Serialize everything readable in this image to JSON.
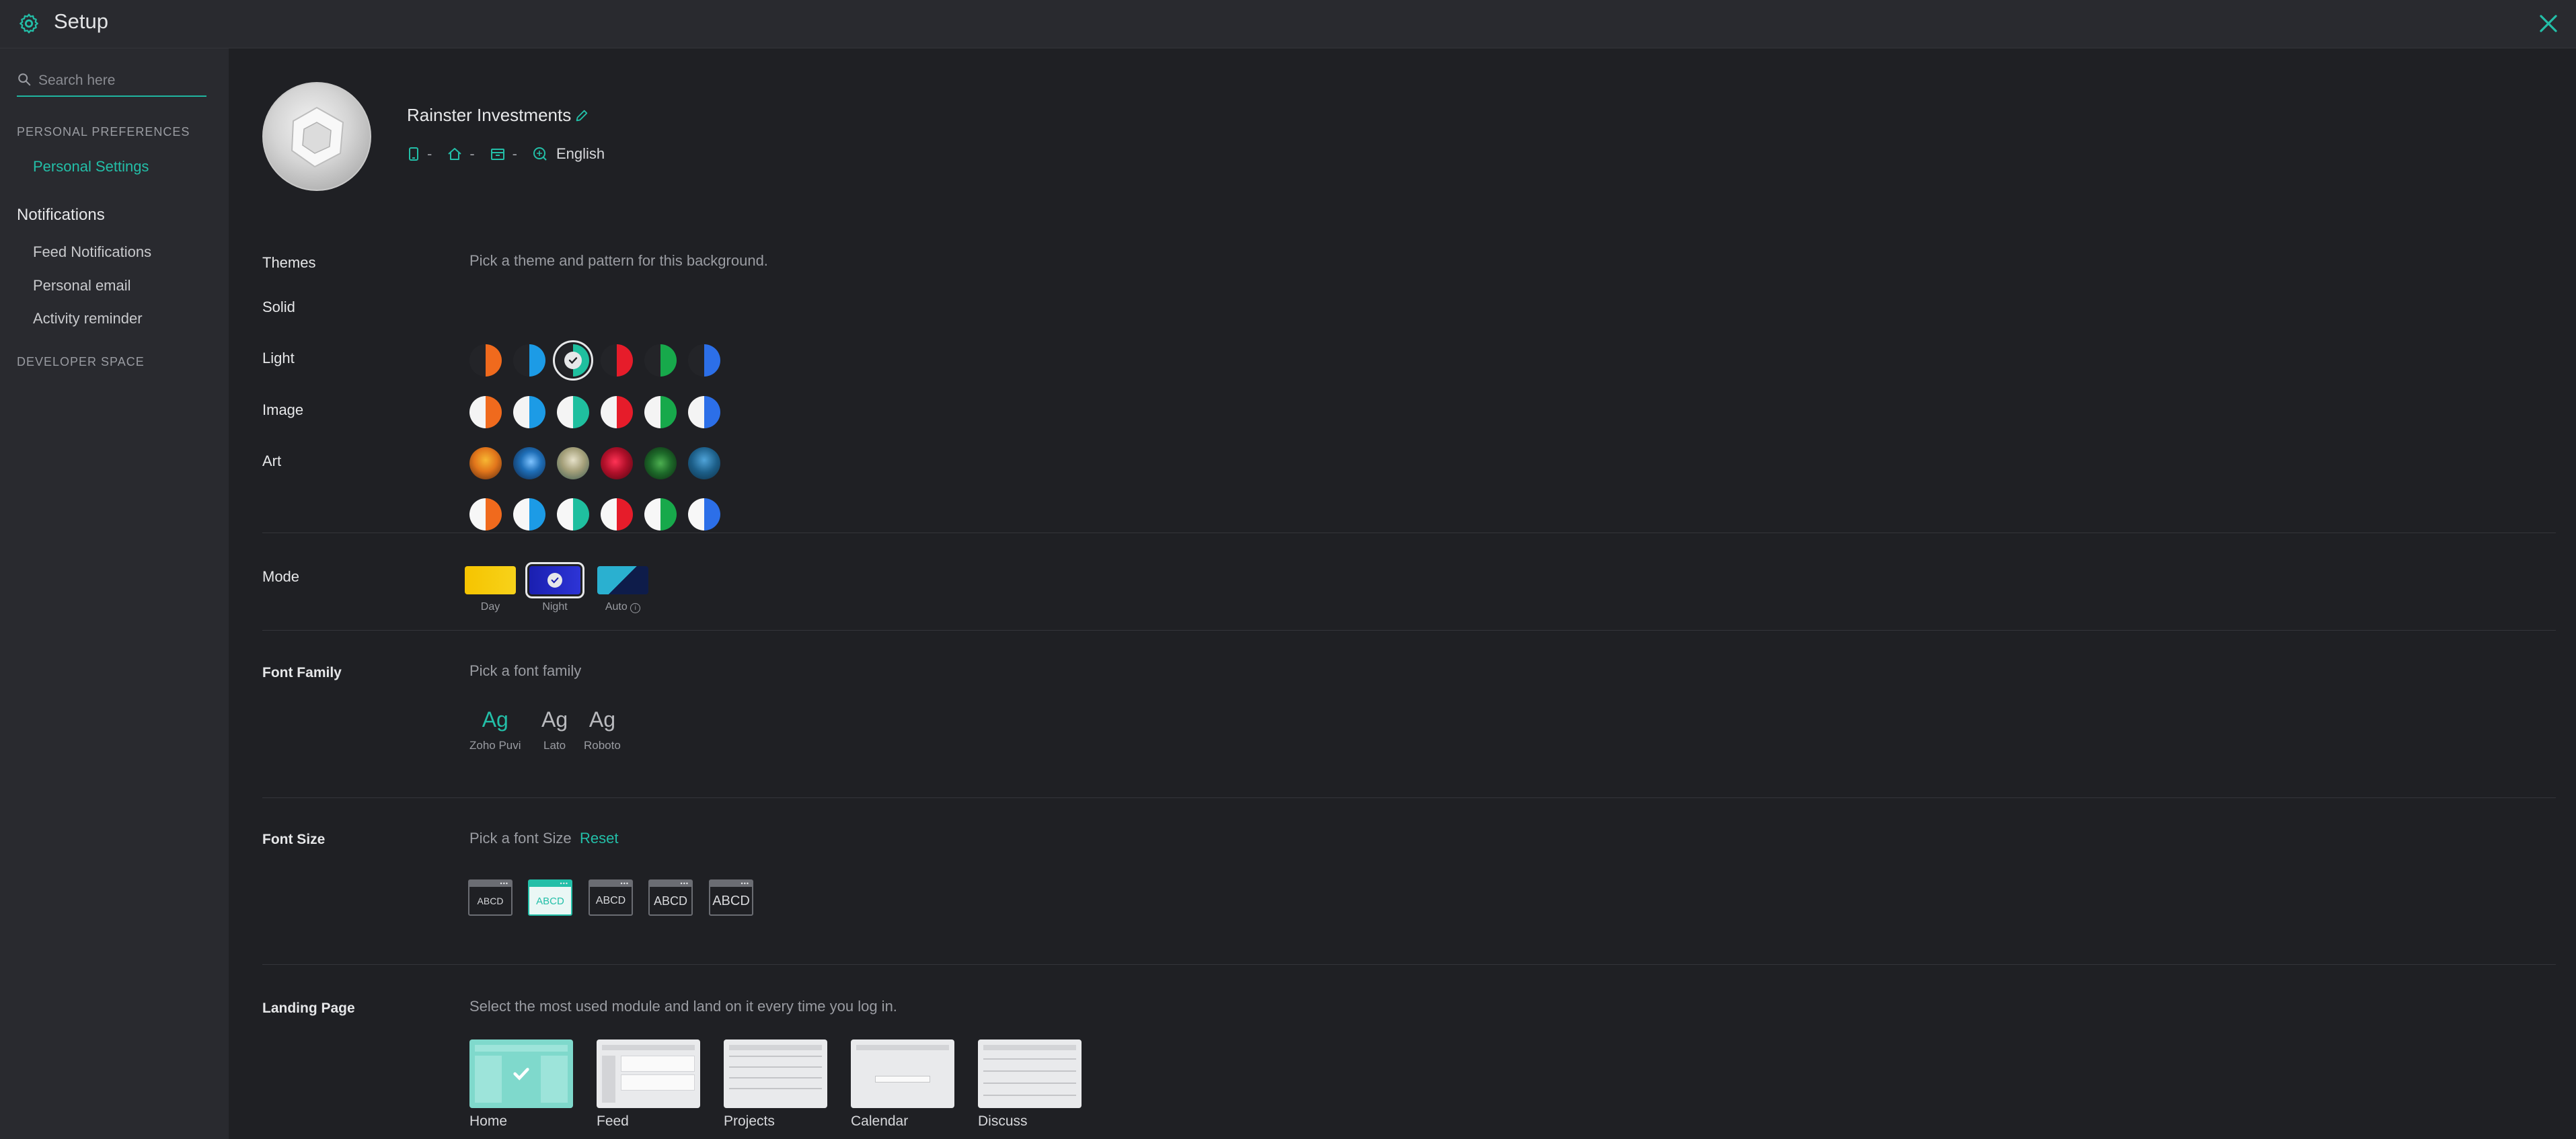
{
  "topbar": {
    "title": "Setup"
  },
  "sidebar": {
    "search_placeholder": "Search here",
    "personal_preferences_label": "PERSONAL PREFERENCES",
    "personal_settings_label": "Personal Settings",
    "notifications_heading": "Notifications",
    "items": [
      {
        "label": "Feed Notifications"
      },
      {
        "label": "Personal email"
      },
      {
        "label": "Activity reminder"
      }
    ],
    "developer_space_label": "DEVELOPER SPACE"
  },
  "profile": {
    "org_name": "Rainster Investments",
    "meta": {
      "phone": "-",
      "home": "-",
      "building": "-",
      "language": "English"
    }
  },
  "themes": {
    "label": "Themes",
    "hint": "Pick a theme and pattern for this background.",
    "rows": [
      {
        "label": "Solid"
      },
      {
        "label": "Light"
      },
      {
        "label": "Image"
      },
      {
        "label": "Art"
      }
    ],
    "accents": [
      "#f06a1d",
      "#1c9be6",
      "#1fbf9f",
      "#e61c2a",
      "#17a94b",
      "#2c6fe8"
    ],
    "selected": {
      "row": "Solid",
      "index": 2
    }
  },
  "mode": {
    "label": "Mode",
    "options": [
      {
        "label": "Day"
      },
      {
        "label": "Night"
      },
      {
        "label": "Auto"
      }
    ],
    "selected": "Night"
  },
  "font_family": {
    "label": "Font Family",
    "hint": "Pick a font family",
    "glyph": "Ag",
    "options": [
      {
        "label": "Zoho Puvi"
      },
      {
        "label": "Lato"
      },
      {
        "label": "Roboto"
      }
    ],
    "selected": "Zoho Puvi"
  },
  "font_size": {
    "label": "Font Size",
    "hint": "Pick a font Size",
    "reset": "Reset",
    "sample": "ABCD",
    "selected_index": 1
  },
  "landing_page": {
    "label": "Landing Page",
    "hint": "Select the most used module and land on it every time you log in.",
    "options": [
      {
        "label": "Home"
      },
      {
        "label": "Feed"
      },
      {
        "label": "Projects"
      },
      {
        "label": "Calendar"
      },
      {
        "label": "Discuss"
      }
    ],
    "selected": "Home"
  },
  "colors": {
    "accent": "#23bfa8",
    "background": "#1f2024",
    "panel": "#292a2f"
  }
}
